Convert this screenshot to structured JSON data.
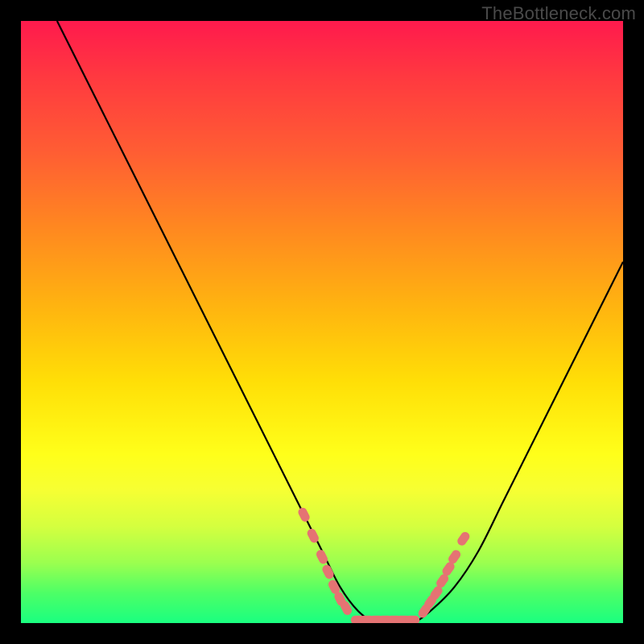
{
  "watermark": "TheBottleneck.com",
  "colors": {
    "background": "#000000",
    "gradient_top": "#ff1a4d",
    "gradient_bottom": "#1aff80",
    "curve": "#000000",
    "marker_fill": "#e57373",
    "marker_stroke": "#c94f4f"
  },
  "chart_data": {
    "type": "line",
    "title": "",
    "xlabel": "",
    "ylabel": "",
    "xlim": [
      0,
      100
    ],
    "ylim": [
      0,
      100
    ],
    "grid": false,
    "legend": false,
    "series": [
      {
        "name": "curve",
        "x": [
          6,
          10,
          14,
          18,
          22,
          26,
          30,
          34,
          38,
          42,
          46,
          50,
          53,
          56,
          59,
          62,
          65,
          68,
          72,
          76,
          80,
          84,
          88,
          92,
          96,
          100
        ],
        "y": [
          100,
          92,
          84,
          76,
          68,
          60,
          52,
          44,
          36,
          28,
          20,
          12,
          6,
          2,
          0,
          0,
          0,
          2,
          6,
          12,
          20,
          28,
          36,
          44,
          52,
          60
        ]
      }
    ],
    "markers": {
      "left_slope": {
        "x": [
          47,
          48.5,
          50,
          51,
          52,
          53,
          54
        ],
        "y": [
          18,
          14.5,
          11,
          8.5,
          6,
          4,
          2.5
        ]
      },
      "flat": {
        "x": [
          56,
          57.5,
          59,
          60.5,
          62,
          63.5,
          65
        ],
        "y": [
          0.5,
          0.5,
          0.5,
          0.5,
          0.5,
          0.5,
          0.5
        ]
      },
      "right_slope": {
        "x": [
          67,
          68,
          69,
          70,
          71,
          72,
          73.5
        ],
        "y": [
          2,
          3.5,
          5,
          7,
          9,
          11,
          14
        ]
      }
    }
  }
}
